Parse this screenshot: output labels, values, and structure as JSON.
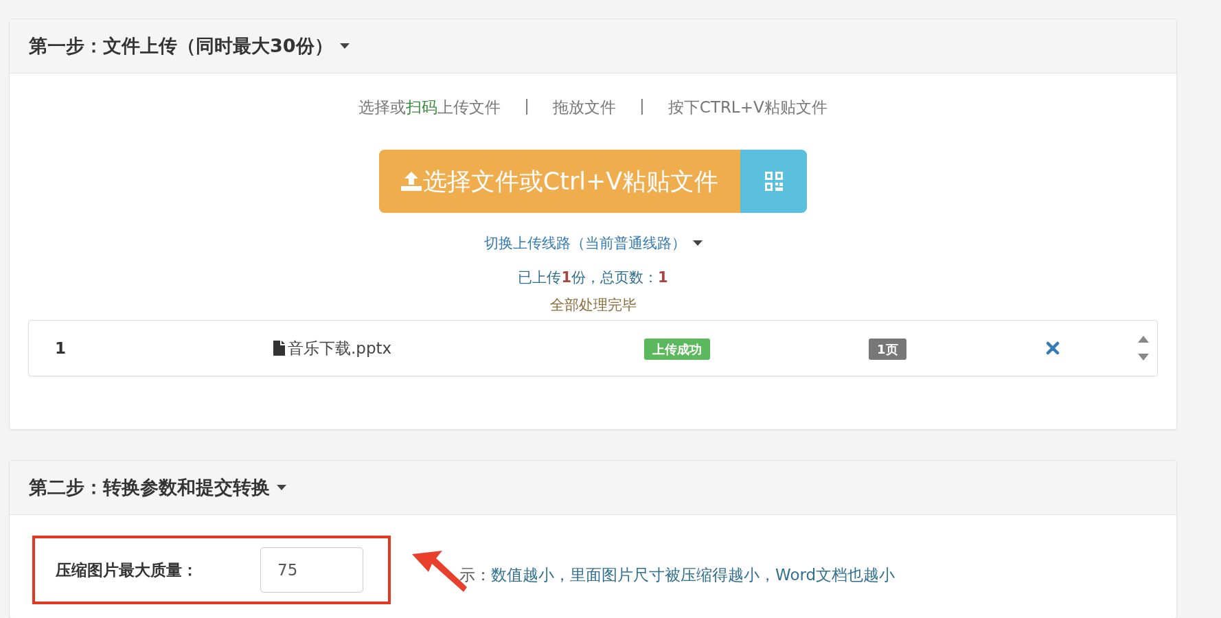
{
  "step1": {
    "title": "第一步：文件上传（同时最大30份）",
    "methods": [
      {
        "before": "选择或",
        "accent": "扫码",
        "after": "上传文件"
      },
      {
        "before": "拖放文件"
      },
      {
        "before": "按下CTRL+V粘贴文件"
      }
    ],
    "separator": "|",
    "upload_button": "选择文件或Ctrl+V粘贴文件",
    "route_link": "切换上传线路（当前普通线路）",
    "summary": [
      {
        "text": "已上传",
        "accent": false
      },
      {
        "text": "1",
        "accent": true
      },
      {
        "text": "份，总页数：",
        "accent": false
      },
      {
        "text": "1",
        "accent": true
      }
    ],
    "status": "全部处理完毕",
    "files": [
      {
        "index": "1",
        "name": "音乐下载.pptx",
        "status": "上传成功",
        "pages": "1页"
      }
    ]
  },
  "step2": {
    "title": "第二步：转换参数和提交转换",
    "quality_label": "压缩图片最大质量：",
    "quality_value": "75",
    "hint_prefix": "示：",
    "hint": "数值越小，里面图片尺寸被压缩得越小，Word文档也越小"
  }
}
